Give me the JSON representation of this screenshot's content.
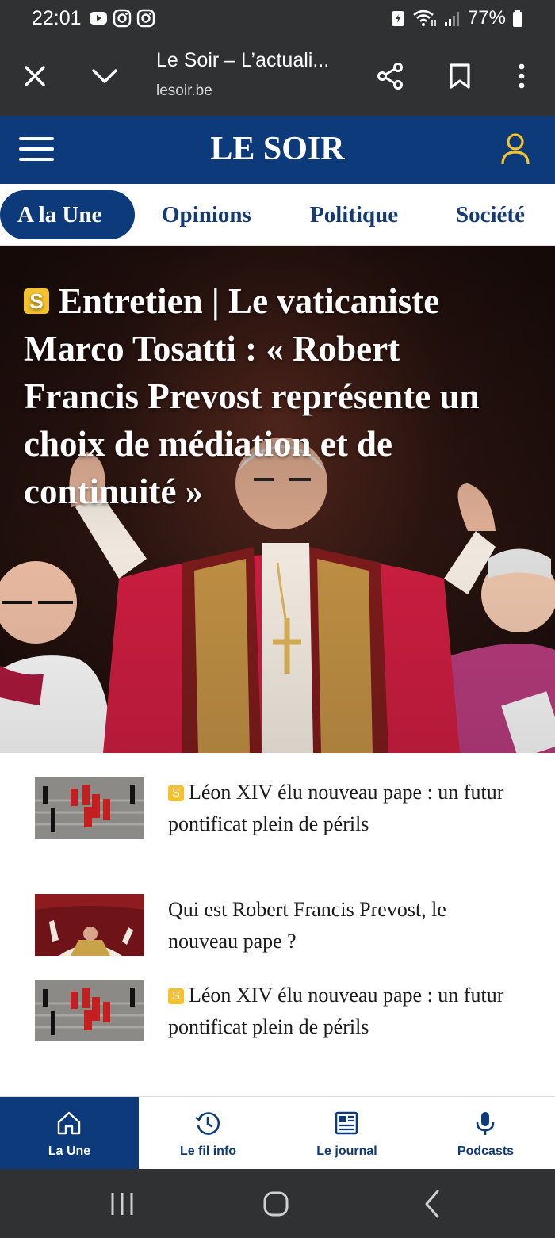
{
  "status_bar": {
    "time": "22:01",
    "battery": "77%",
    "left_icons": [
      "youtube-icon",
      "instagram-icon",
      "instagram-icon"
    ],
    "right_icons": [
      "battery-saver-icon",
      "wifi-icon",
      "signal-icon",
      "battery-icon"
    ]
  },
  "browser": {
    "title": "Le Soir – L’actuali...",
    "url": "lesoir.be"
  },
  "site": {
    "logo": "LE SOIR"
  },
  "nav_tabs": [
    {
      "label": "A la Une",
      "active": true
    },
    {
      "label": "Opinions",
      "active": false
    },
    {
      "label": "Politique",
      "active": false
    },
    {
      "label": "Société",
      "active": false
    }
  ],
  "hero": {
    "badge": "S",
    "title": "Entretien | Le vaticaniste Marco Tosatti : « Robert Francis Prevost représente un choix de médiation et de continuité »"
  },
  "related": [
    {
      "premium": true,
      "badge": "S",
      "title": "Léon XIV élu nouveau pape : un futur pontificat plein de périls"
    },
    {
      "premium": false,
      "badge": "",
      "title": "Qui est Robert Francis Prevost, le nouveau pape ?"
    },
    {
      "premium": true,
      "badge": "S",
      "title": "Léon XIV élu nouveau pape : un futur pontificat plein de périls"
    }
  ],
  "bottom_nav": [
    {
      "label": "La Une",
      "icon": "home-icon",
      "active": true
    },
    {
      "label": "Le fil info",
      "icon": "clock-icon",
      "active": false
    },
    {
      "label": "Le journal",
      "icon": "newspaper-icon",
      "active": false
    },
    {
      "label": "Podcasts",
      "icon": "microphone-icon",
      "active": false
    }
  ],
  "colors": {
    "brand": "#0d3a7a",
    "premium": "#f3c22e",
    "system_bar": "#2f3133"
  }
}
